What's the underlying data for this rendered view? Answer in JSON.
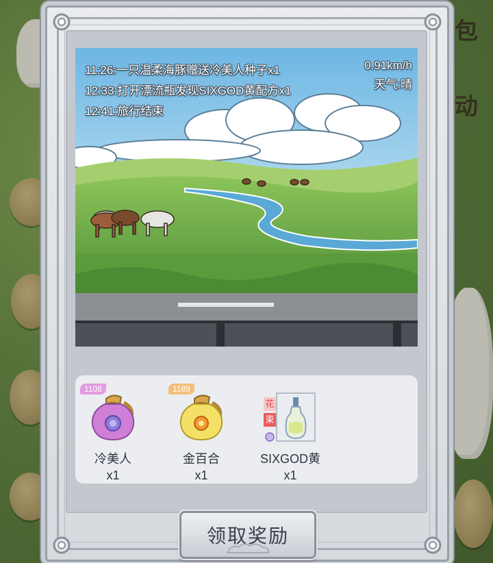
{
  "travel_log": {
    "entries": [
      "11:26:一只温柔海豚赠送冷美人种子x1",
      "12:33:打开漂流瓶发现SIXGOD黄配方x1",
      "12:41:旅行结束"
    ],
    "speed": "0.91km/h",
    "weather": "天气:晴"
  },
  "rewards": [
    {
      "badge": "1108",
      "name": "冷美人",
      "count": "x1",
      "icon": "purple-seed-bag-icon",
      "badge_color": "#e39be0"
    },
    {
      "badge": "1189",
      "name": "金百合",
      "count": "x1",
      "icon": "yellow-seed-bag-icon",
      "badge_color": "#f3c07a"
    },
    {
      "tags": [
        "花",
        "束"
      ],
      "name": "SIXGOD黄",
      "count": "x1",
      "icon": "perfume-bottle-icon"
    }
  ],
  "claim_button": {
    "label": "领取奖励"
  },
  "background": {
    "side_text_top": "包",
    "side_text_mid": "动"
  }
}
